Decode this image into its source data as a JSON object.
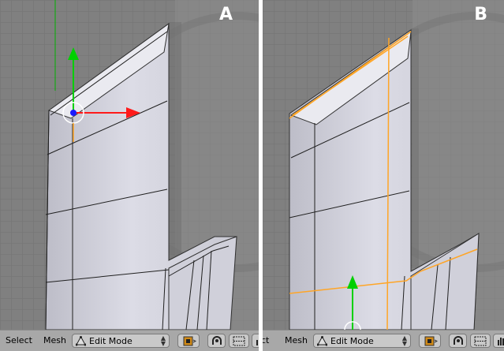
{
  "panels": [
    {
      "label": "A"
    },
    {
      "label": "B"
    }
  ],
  "header": {
    "select_label": "Select",
    "select_label_partial": "ct",
    "mesh_label": "Mesh",
    "mode": "Edit Mode"
  },
  "colors": {
    "viewport_bg": "#808080",
    "grid_line": "#727272",
    "mesh_fill": "#d8d8e2",
    "wire": "#202020",
    "selected_edge": "#ffa526",
    "axis_y": "#00cc00",
    "axis_x": "#ff0000",
    "header_bg": "#a8a8a8"
  },
  "icons": [
    "edit-mode-triangle-icon",
    "object-pivot-icon",
    "proportional-edit-icon",
    "snap-grid-icon",
    "hand-icon"
  ]
}
